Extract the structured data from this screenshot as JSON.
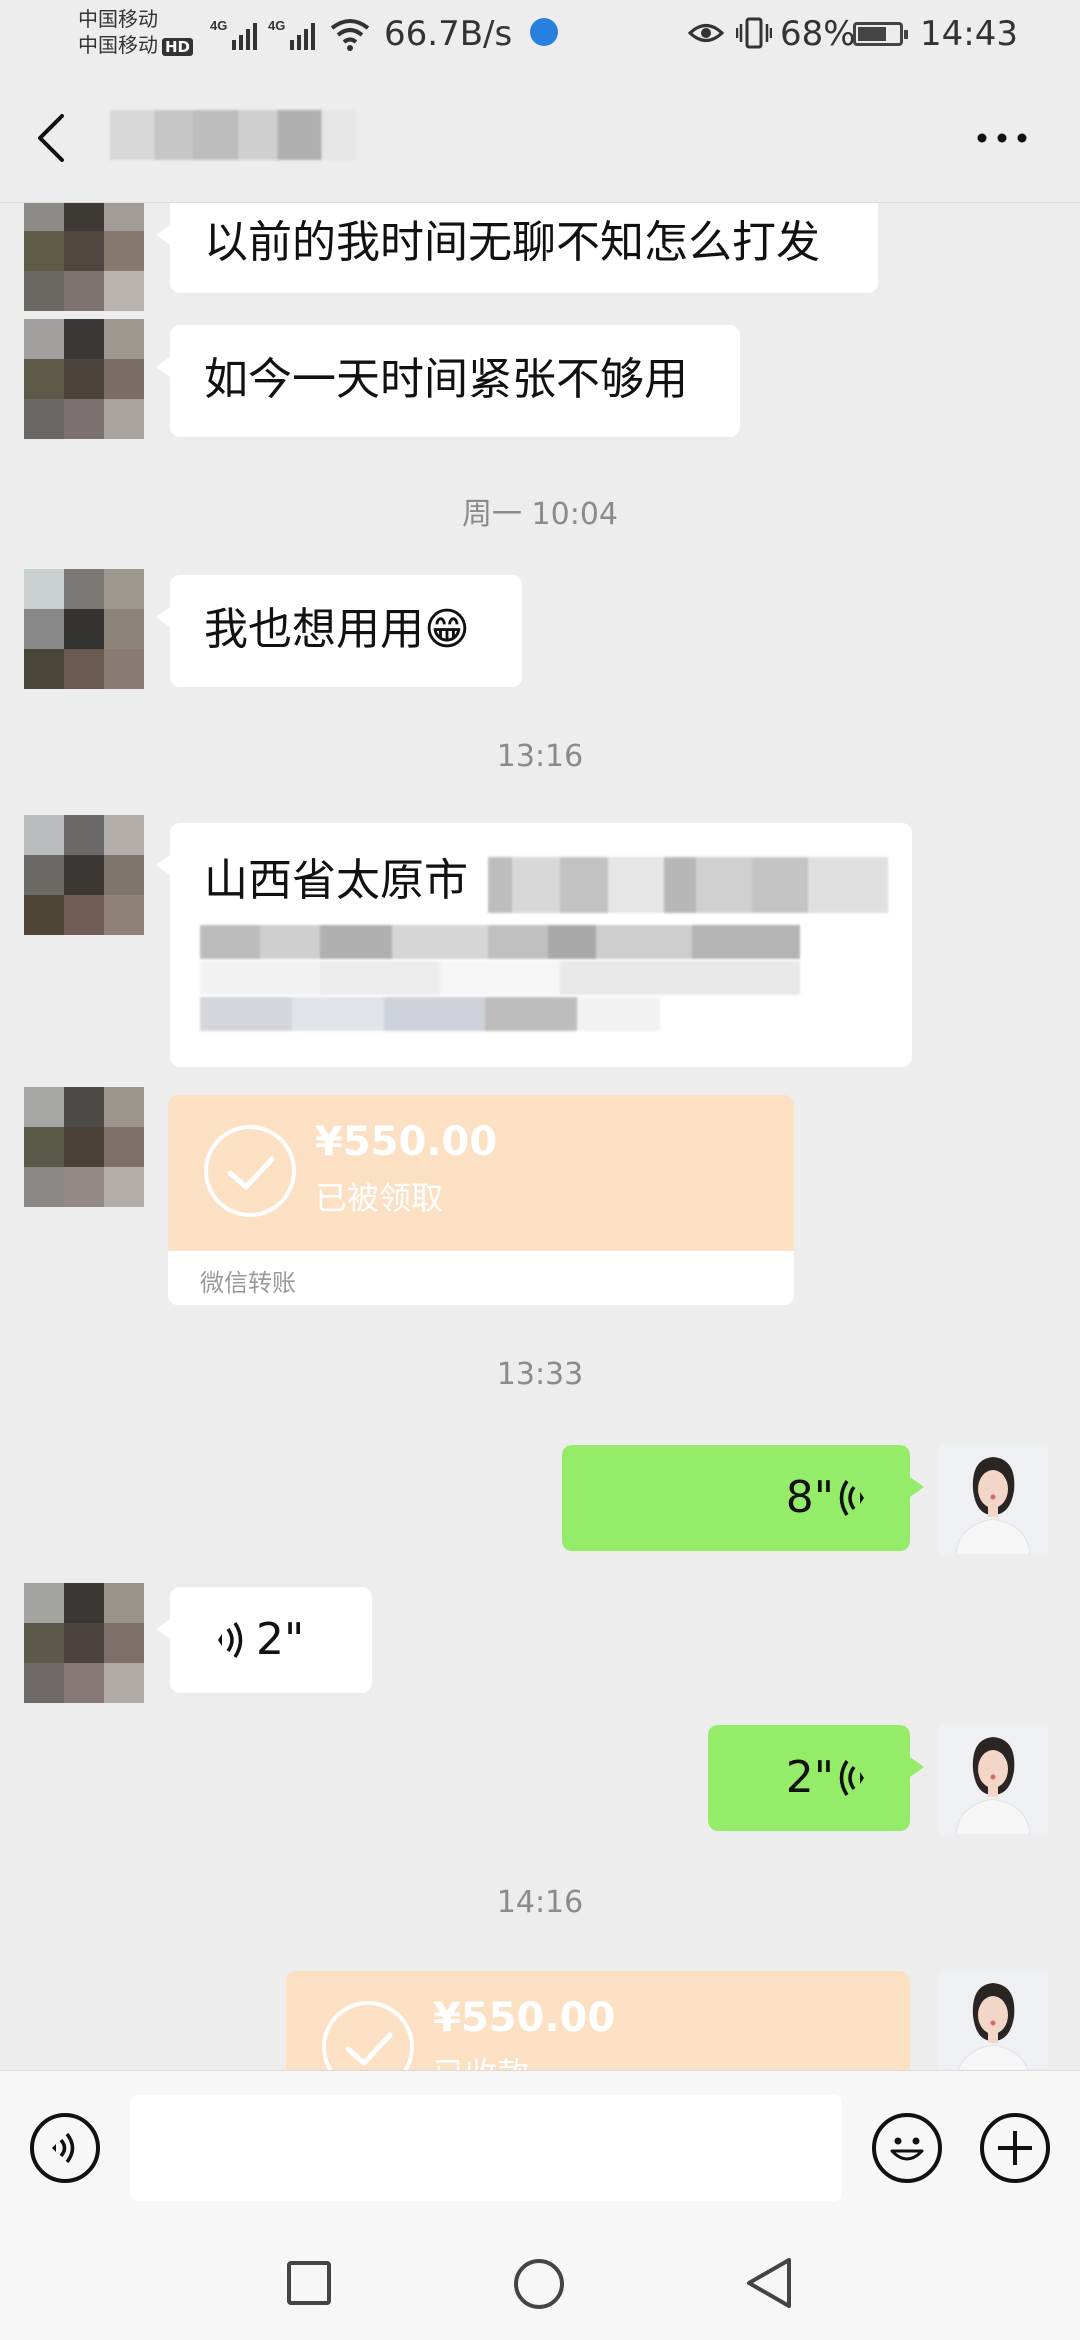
{
  "status_bar": {
    "carrier_1": "中国移动",
    "carrier_2": "中国移动",
    "hd_badge": "HD",
    "network_1": "4G",
    "network_2": "4G",
    "net_speed": "66.7B/s",
    "battery_percent": "68%",
    "battery_level": 0.68,
    "time": "14:43"
  },
  "header": {
    "back_icon": "chevron-left-icon",
    "more_icon": "ellipsis-icon"
  },
  "messages": [
    {
      "side": "left",
      "type": "text",
      "text": "以前的我时间无聊不知怎么打发"
    },
    {
      "side": "left",
      "type": "text",
      "text": "如今一天时间紧张不够用"
    },
    {
      "type": "time",
      "text": "周一 10:04"
    },
    {
      "side": "left",
      "type": "text",
      "text": "我也想用用😁"
    },
    {
      "type": "time",
      "text": "13:16"
    },
    {
      "side": "left",
      "type": "text",
      "text": "山西省太原市"
    },
    {
      "side": "left",
      "type": "transfer",
      "amount": "¥550.00",
      "status": "已被领取",
      "brand": "微信转账"
    },
    {
      "type": "time",
      "text": "13:33"
    },
    {
      "side": "right",
      "type": "voice",
      "duration": "8\""
    },
    {
      "side": "left",
      "type": "voice",
      "duration": "2\""
    },
    {
      "side": "right",
      "type": "voice",
      "duration": "2\""
    },
    {
      "type": "time",
      "text": "14:16"
    },
    {
      "side": "right",
      "type": "transfer",
      "amount": "¥550.00",
      "status": "已收款"
    }
  ],
  "input_bar": {
    "voice_icon": "voice-mode-icon",
    "emoji_icon": "emoji-icon",
    "plus_icon": "plus-icon"
  },
  "nav_bar": {
    "recent_icon": "square-icon",
    "home_icon": "circle-icon",
    "back_icon": "triangle-back-icon"
  },
  "colors": {
    "background": "#ededed",
    "self_bubble": "#95ec69",
    "other_bubble": "#ffffff",
    "transfer": "#fce0c3"
  }
}
